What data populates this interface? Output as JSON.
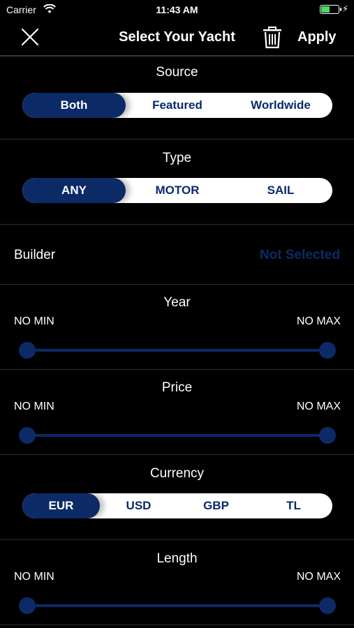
{
  "status_bar": {
    "carrier": "Carrier",
    "time": "11:43 AM",
    "charge_symbol": "⚡"
  },
  "nav": {
    "title": "Select Your Yacht",
    "apply_label": "Apply",
    "close_icon": "close-icon",
    "trash_icon": "trash-icon"
  },
  "source": {
    "title": "Source",
    "options": [
      "Both",
      "Featured",
      "Worldwide"
    ],
    "selected": "Both"
  },
  "type": {
    "title": "Type",
    "options": [
      "ANY",
      "MOTOR",
      "SAIL"
    ],
    "selected": "ANY"
  },
  "builder": {
    "label": "Builder",
    "value": "Not Selected"
  },
  "year": {
    "title": "Year",
    "min_label": "NO MIN",
    "max_label": "NO MAX"
  },
  "price": {
    "title": "Price",
    "min_label": "NO MIN",
    "max_label": "NO MAX"
  },
  "currency": {
    "title": "Currency",
    "options": [
      "EUR",
      "USD",
      "GBP",
      "TL"
    ],
    "selected": "EUR"
  },
  "length": {
    "title": "Length",
    "min_label": "NO MIN",
    "max_label": "NO MAX"
  },
  "colors": {
    "background": "#000000",
    "accent_navy": "#0c2a66",
    "segment_bg": "#ffffff",
    "battery_green": "#4cd964"
  }
}
